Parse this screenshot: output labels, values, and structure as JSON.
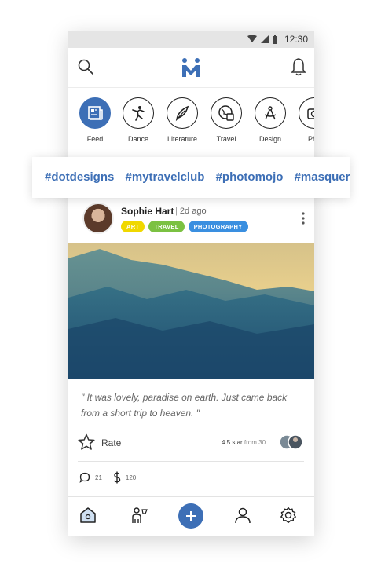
{
  "status_bar": {
    "time": "12:30"
  },
  "header": {
    "search_icon": "search-icon",
    "logo_icon": "app-logo",
    "notification_icon": "bell-icon"
  },
  "categories": [
    {
      "label": "Feed",
      "icon": "newspaper-icon",
      "active": true
    },
    {
      "label": "Dance",
      "icon": "dancer-icon",
      "active": false
    },
    {
      "label": "Literature",
      "icon": "quill-icon",
      "active": false
    },
    {
      "label": "Travel",
      "icon": "globe-luggage-icon",
      "active": false
    },
    {
      "label": "Design",
      "icon": "compass-icon",
      "active": false
    },
    {
      "label": "Pho",
      "icon": "camera-icon",
      "active": false
    }
  ],
  "hashtags": [
    "#dotdesigns",
    "#mytravelclub",
    "#photomojo",
    "#masquerad"
  ],
  "post": {
    "author": "Sophie Hart",
    "time": "2d ago",
    "tags": [
      {
        "label": "ART",
        "color": "#f0d800"
      },
      {
        "label": "TRAVEL",
        "color": "#7bc142"
      },
      {
        "label": "PHOTOGRAPHY",
        "color": "#3a8fe0"
      }
    ],
    "quote": "\" It was lovely, paradise on earth. Just came back from a short trip to heaven. \"",
    "rate_label": "Rate",
    "rating_value": "4.5 star",
    "rating_from": "from 30",
    "comments_count": "21",
    "tips_count": "120"
  },
  "colors": {
    "accent": "#3d6fb6"
  },
  "bottom_nav": [
    "home-icon",
    "community-icon",
    "add-icon",
    "profile-icon",
    "settings-icon"
  ]
}
